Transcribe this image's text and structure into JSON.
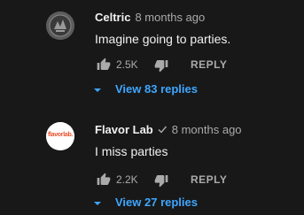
{
  "comments": [
    {
      "author": "Celtric",
      "time": "8 months ago",
      "verified": false,
      "text": "Imagine going to parties.",
      "like_count": "2.5K",
      "reply_label": "REPLY",
      "view_replies_label": "View 83 replies"
    },
    {
      "author": "Flavor Lab",
      "time": "8 months ago",
      "verified": true,
      "avatar_text": "flavorlab.",
      "text": "I miss parties",
      "like_count": "2.2K",
      "reply_label": "REPLY",
      "view_replies_label": "View 27 replies"
    }
  ],
  "colors": {
    "background": "#181818",
    "link": "#3ea6ff",
    "secondary_text": "#aaaaaa"
  },
  "icons": [
    "thumb-up-icon",
    "thumb-down-icon",
    "caret-down-icon",
    "verified-check-icon"
  ]
}
